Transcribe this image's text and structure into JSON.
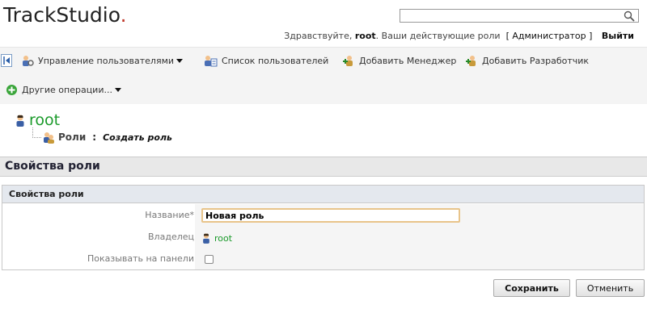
{
  "logo": {
    "text": "TrackStudio",
    "dot": "."
  },
  "search": {
    "value": "",
    "placeholder": ""
  },
  "header": {
    "greeting": "Здравствуйте,",
    "user": "root",
    "roles_text": ". Ваши действующие роли",
    "role_open": "[",
    "role": "Администратор",
    "role_close": "]",
    "exit": "Выйти"
  },
  "toolbar": {
    "items": [
      {
        "label": "Управление пользователями"
      },
      {
        "label": "Список пользователей"
      },
      {
        "label": "Добавить Менеджер"
      },
      {
        "label": "Добавить Разработчик"
      },
      {
        "label": "Другие операции..."
      }
    ]
  },
  "breadcrumb": {
    "root": "root",
    "roles": "Роли",
    "sep": ":",
    "current": "Создать роль"
  },
  "page_title": "Свойства роли",
  "panel": {
    "title": "Свойства роли",
    "name_label": "Название*",
    "name_value": "Новая роль",
    "owner_label": "Владелец",
    "owner_value": "root",
    "show_label": "Показывать на панели"
  },
  "buttons": {
    "save": "Сохранить",
    "cancel": "Отменить"
  },
  "colors": {
    "accent_green": "#1a9a2a",
    "logo_dot": "#c0392b",
    "focus_border": "#e8c48a"
  }
}
